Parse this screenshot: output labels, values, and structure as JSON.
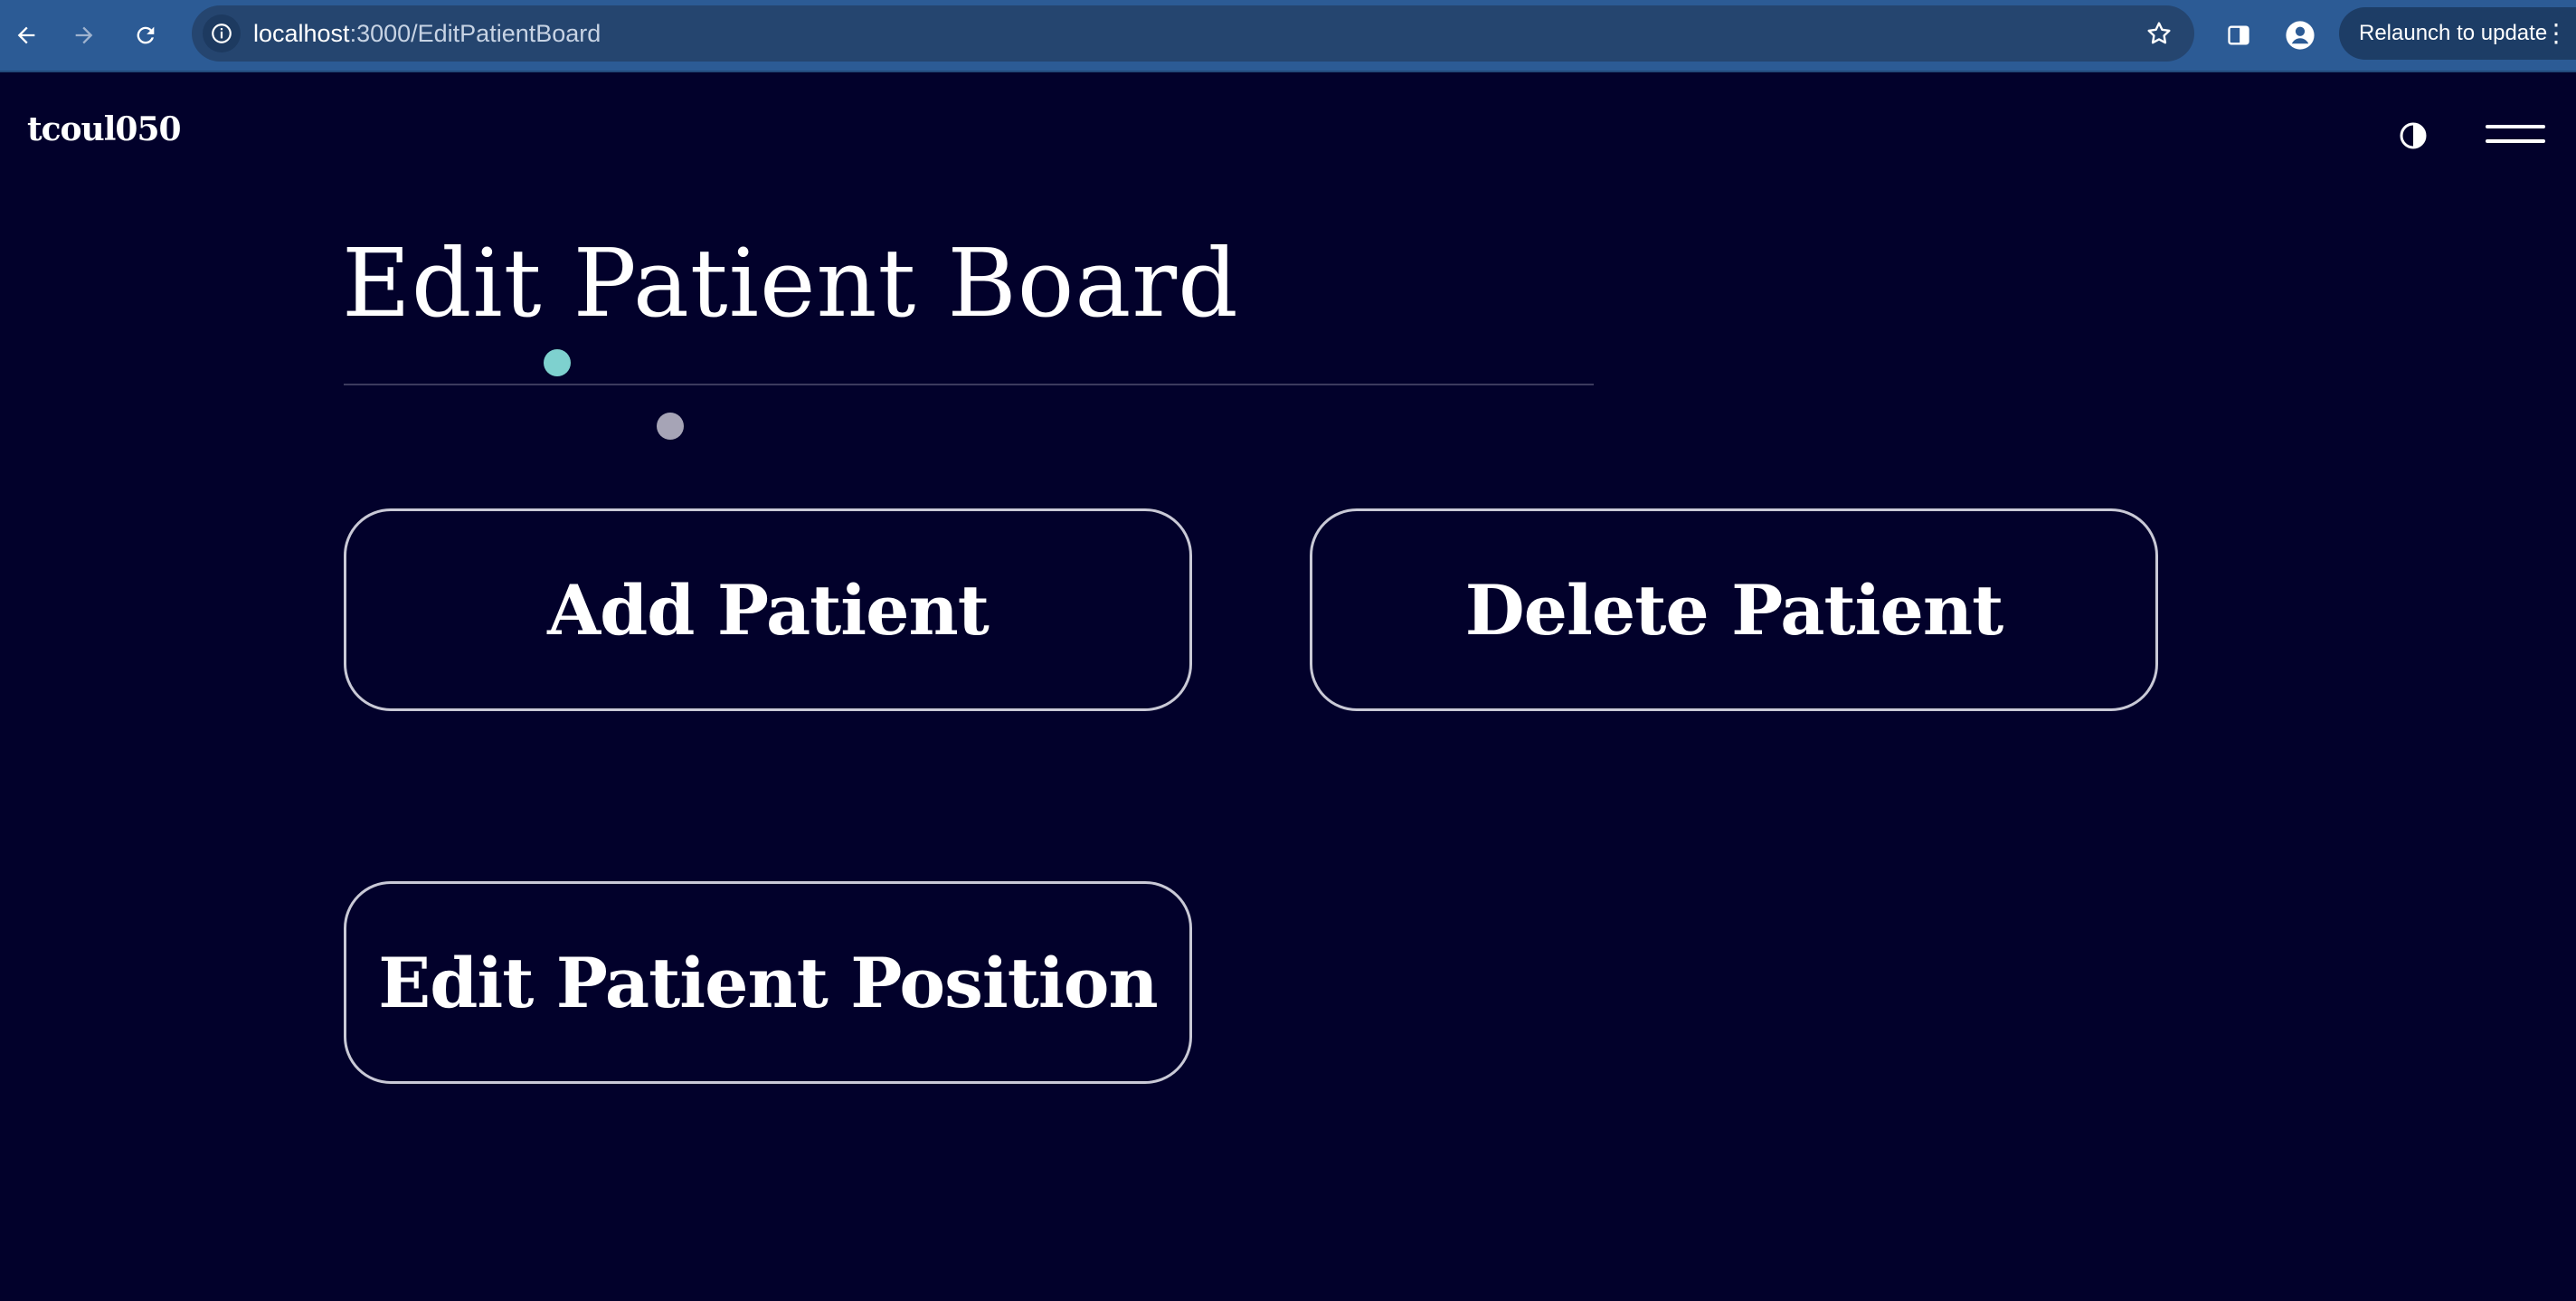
{
  "browser": {
    "url_host": "localhost",
    "url_path": ":3000/EditPatientBoard",
    "relaunch_label": "Relaunch to update",
    "icons": [
      "back-arrow-icon",
      "forward-arrow-icon",
      "reload-icon",
      "site-info-icon",
      "bookmark-star-icon",
      "side-panel-icon",
      "profile-icon",
      "kebab-menu-icon"
    ]
  },
  "header": {
    "brand": "tcoul050",
    "icons": [
      "contrast-icon",
      "hamburger-menu-icon"
    ]
  },
  "main": {
    "title": "Edit Patient Board",
    "buttons": {
      "add": "Add Patient",
      "delete": "Delete Patient",
      "edit_position": "Edit Patient Position"
    }
  },
  "colors": {
    "background": "#02012b",
    "browser_bar": "#2c5b95",
    "button_border": "#c9c9d6",
    "accent_teal": "#7ed1cf",
    "accent_gray": "#a6a4b6"
  }
}
